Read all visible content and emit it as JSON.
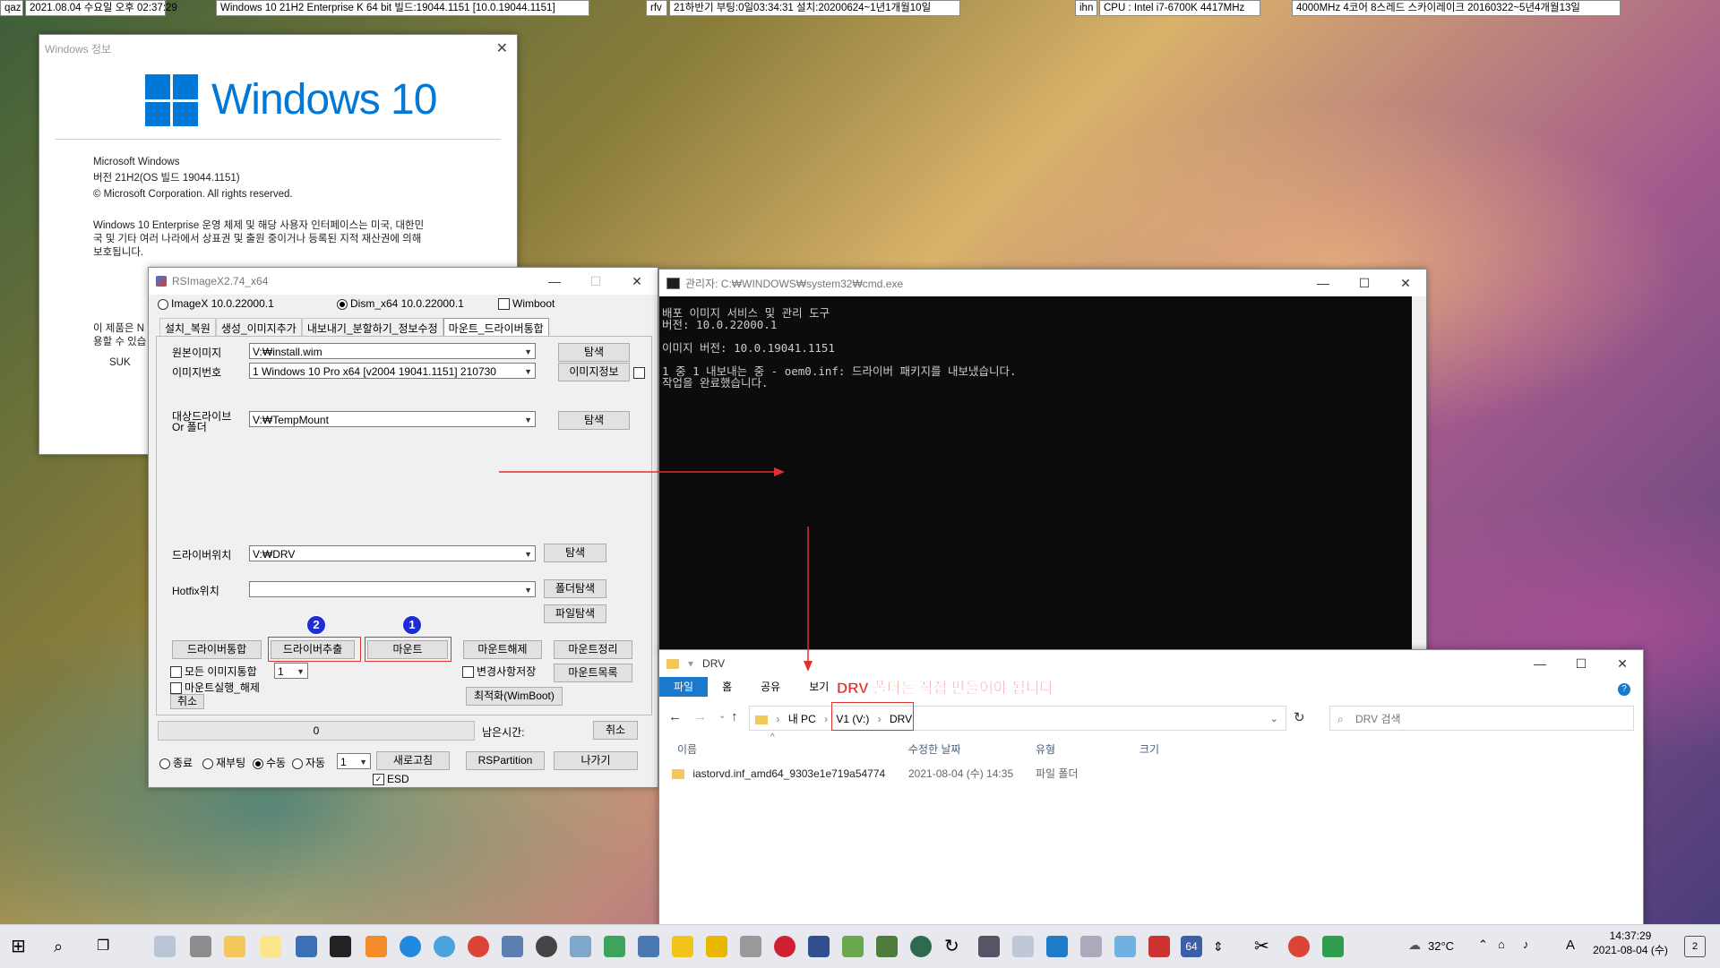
{
  "topbars": {
    "qaz": "qaz",
    "datetime": "2021.08.04 수요일 오후 02:37:29",
    "os_build": "Windows 10 21H2 Enterprise K 64 bit 빌드:19044.1151 [10.0.19044.1151]",
    "rfv": "rfv",
    "boot_info": "21하반기 부팅:0일03:34:31 설치:20200624~1년1개월10일",
    "ihn": "ihn",
    "cpu": "CPU : Intel i7-6700K 4417MHz",
    "cpu_info": "4000MHz 4코어 8스레드 스카이레이크 20160322~5년4개월13일"
  },
  "about": {
    "title": "Windows 정보",
    "logo_text": "Windows 10",
    "line1": "Microsoft Windows",
    "line2": "버전 21H2(OS 빌드 19044.1151)",
    "line3": "© Microsoft Corporation. All rights reserved.",
    "para1": "Windows 10 Enterprise 운영 체제 및 해당 사용자 인터페이스는 미국, 대한민",
    "para2": "국 및 기타 여러 나라에서 상표권 및 출원 중이거나 등록된 지적 재산권에 의해",
    "para3": "보호됩니다.",
    "para4": "이 제품은 N",
    "para5": "용할 수 있습",
    "user": "SUK"
  },
  "rsimage": {
    "title": "RSImageX2.74_x64",
    "radio_imagex": "ImageX 10.0.22000.1",
    "radio_dism": "Dism_x64 10.0.22000.1",
    "wimboot": "Wimboot",
    "tabs": [
      "설치_복원",
      "생성_이미지추가",
      "내보내기_분할하기_정보수정",
      "마운트_드라이버통합"
    ],
    "label_source": "원본이미지",
    "source_value": "V:₩install.wim",
    "browse1": "탐색",
    "label_index": "이미지번호",
    "index_value": "1  Windows 10 Pro x64 [v2004 19041.1151] 210730",
    "image_info": "이미지정보",
    "label_target1": "대상드라이브",
    "label_target2": "Or 폴더",
    "target_value": "V:₩TempMount",
    "browse2": "탐색",
    "label_driver": "드라이버위치",
    "driver_value": "V:₩DRV",
    "browse3": "탐색",
    "label_hotfix": "Hotfix위치",
    "hotfix_value": "",
    "folder_browse": "폴더탐색",
    "file_browse": "파일탐색",
    "btn_driver_integrate": "드라이버통합",
    "btn_driver_extract": "드라이버추출",
    "btn_mount": "마운트",
    "btn_unmount": "마운트해제",
    "btn_mount_cleanup": "마운트정리",
    "chk_all_images": "모든 이미지통합",
    "all_images_num": "1",
    "chk_save_changes": "변경사항저장",
    "btn_mount_list": "마운트목록",
    "chk_unmount_run": "마운트실행_해제",
    "btn_cancel_small": "취소",
    "btn_optimize": "최적화(WimBoot)",
    "progress_value": "0",
    "remaining": "남은시간:",
    "btn_cancel": "취소",
    "radio_exit": "종료",
    "radio_reboot": "재부팅",
    "radio_manual": "수동",
    "radio_auto": "자동",
    "bottom_num": "1",
    "btn_refresh": "새로고침",
    "btn_rspartition": "RSPartition",
    "btn_exit": "나가기",
    "chk_esd": "ESD",
    "badge1": "1",
    "badge2": "2"
  },
  "cmd": {
    "title": "관리자: C:₩WINDOWS₩system32₩cmd.exe",
    "lines": "배포 이미지 서비스 및 관리 도구\n버전: 10.0.22000.1\n\n이미지 버전: 10.0.19041.1151\n\n1 중 1 내보내는 중 - oem0.inf: 드라이버 패키지를 내보냈습니다.\n작업을 완료했습니다."
  },
  "explorer": {
    "title": "DRV",
    "tab_file": "파일",
    "tab_home": "홈",
    "tab_share": "공유",
    "tab_view": "보기",
    "annotation": "DRV 폴더는 직접 만들어야 됩니다",
    "crumb_pc": "내 PC",
    "crumb_drive": "V1 (V:)",
    "crumb_folder": "DRV",
    "search_placeholder": "DRV 검색",
    "col_name": "이름",
    "col_date": "수정한 날짜",
    "col_type": "유형",
    "col_size": "크기",
    "row_name": "iastorvd.inf_amd64_9303e1e719a54774",
    "row_date": "2021-08-04 (수) 14:35",
    "row_type": "파일 폴더"
  },
  "taskbar": {
    "temperature": "32°C",
    "lang": "A",
    "time": "14:37:29",
    "date": "2021-08-04 (수)",
    "notification_count": "2"
  },
  "colors": {
    "accent": "#1979ca",
    "annotation": "#e03030",
    "badge": "#1f2ed4"
  }
}
